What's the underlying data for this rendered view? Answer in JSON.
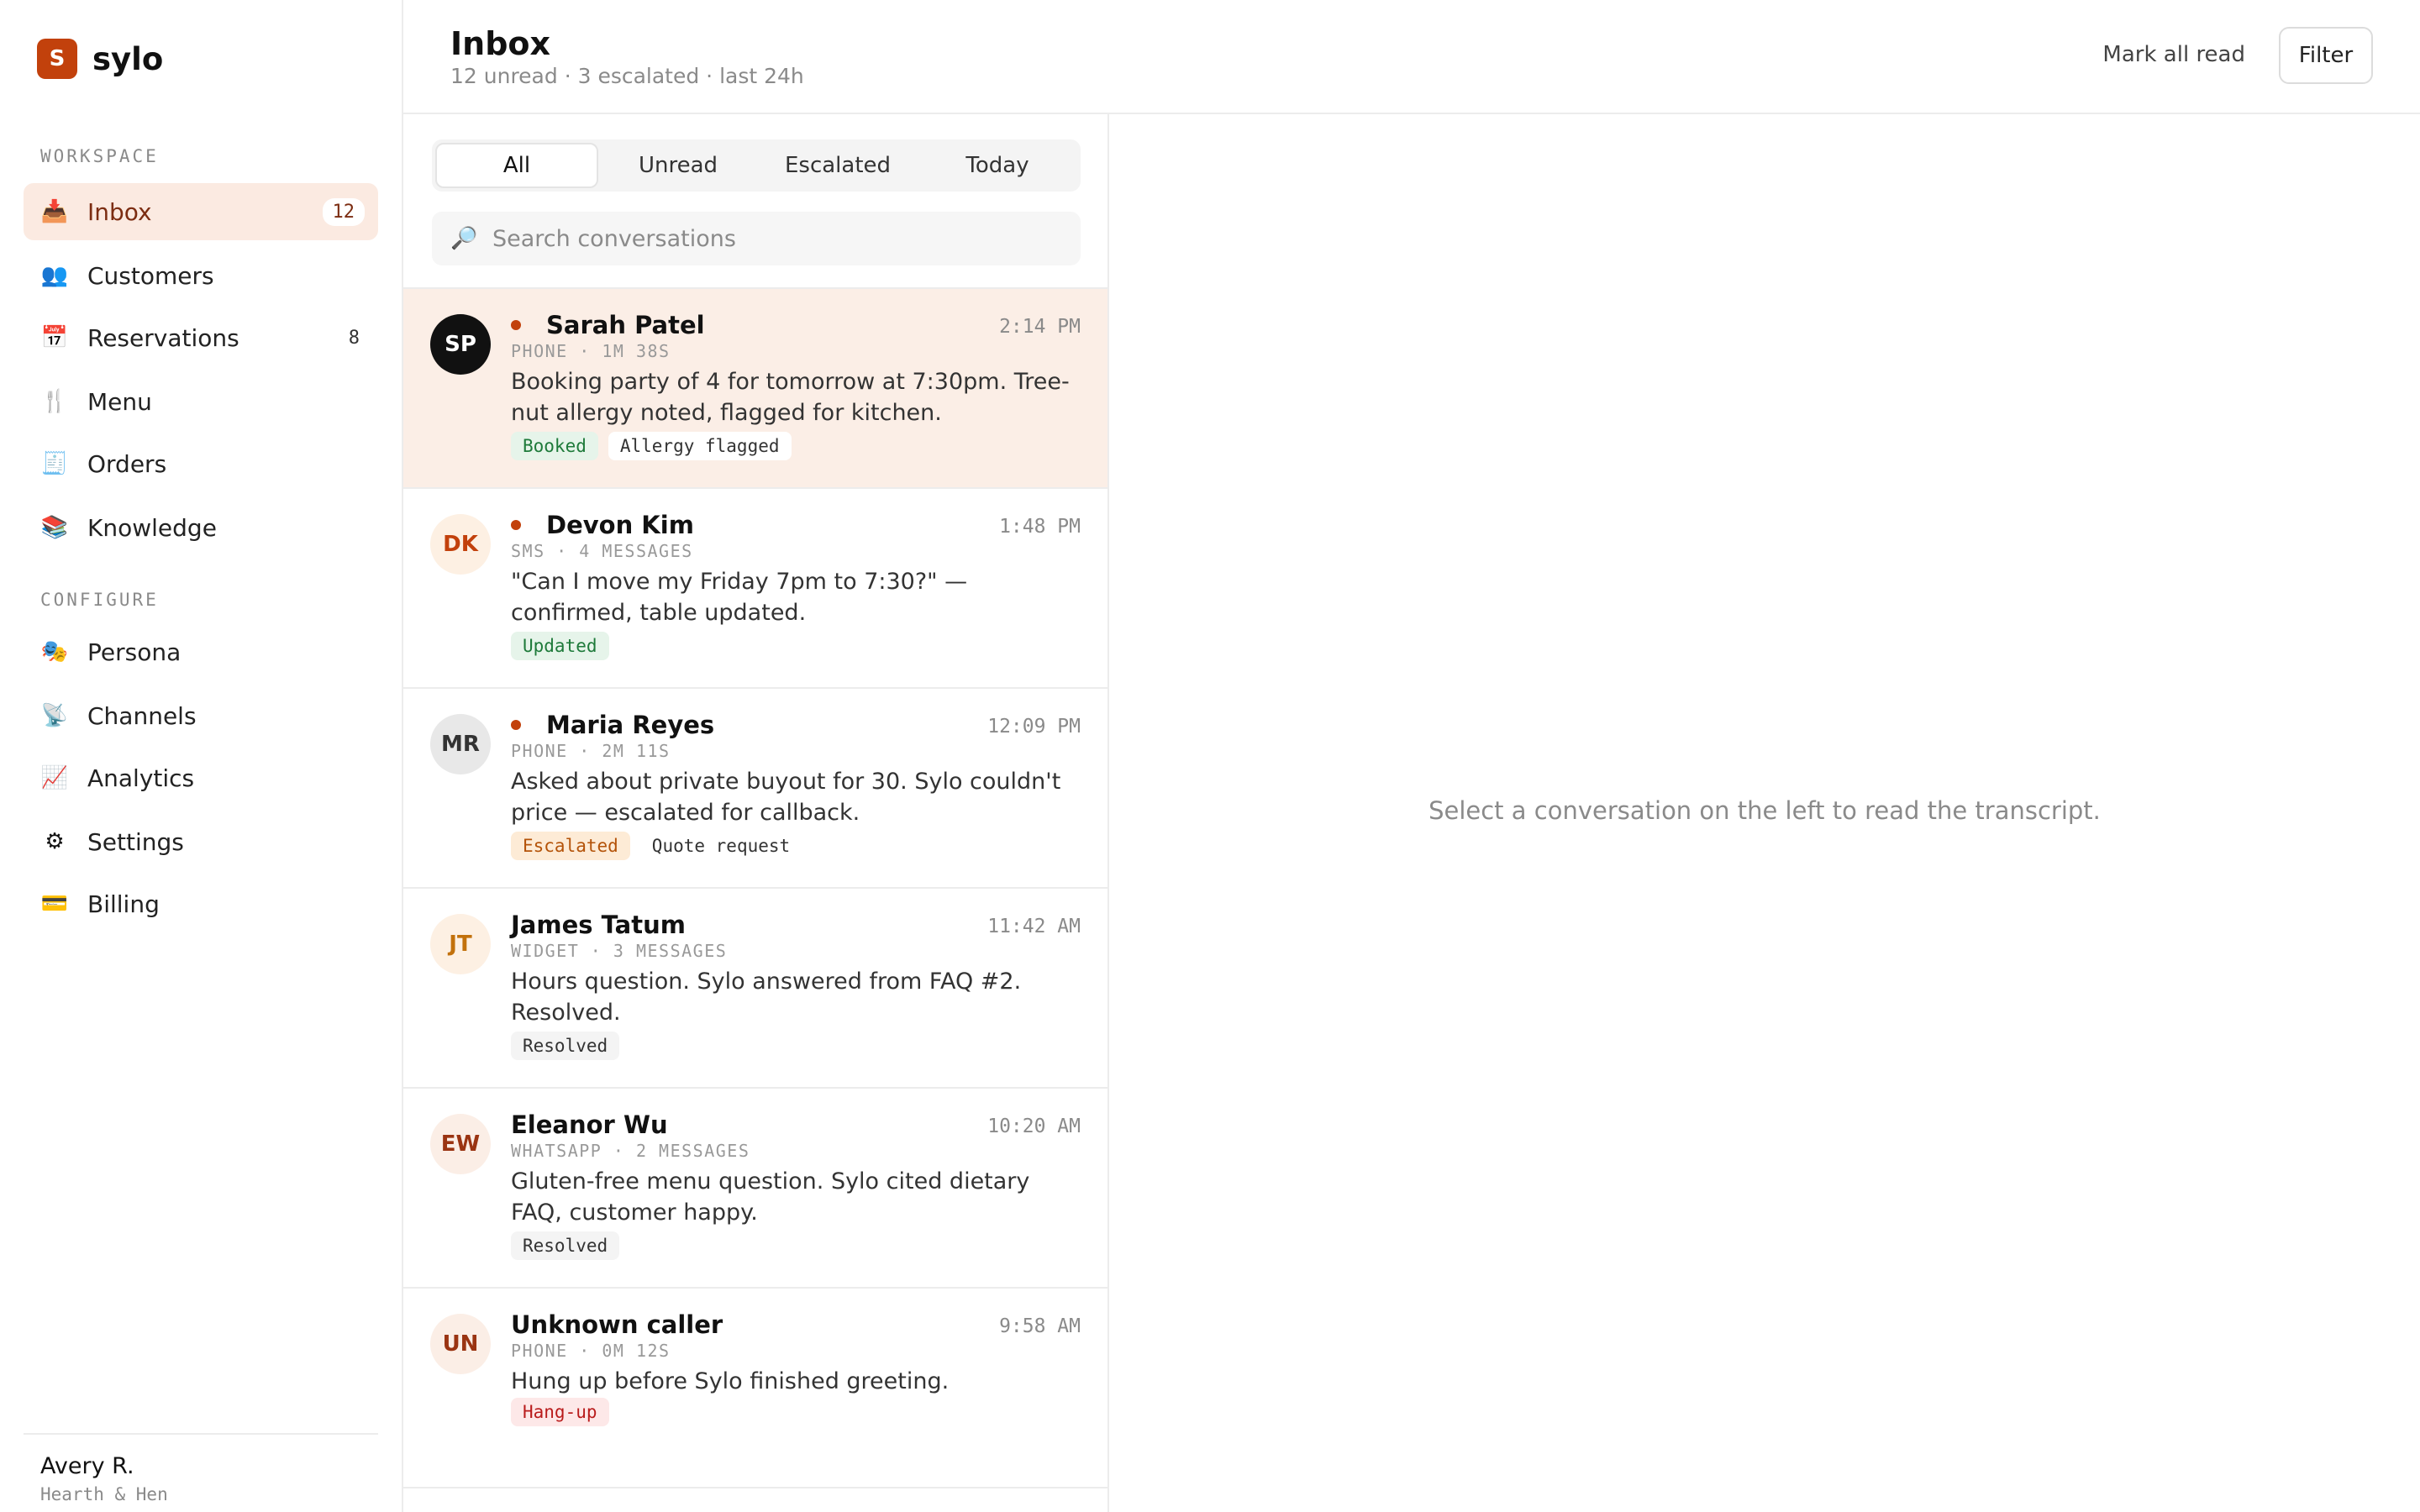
{
  "brand": {
    "mark": "S",
    "name": "sylo"
  },
  "sidebar": {
    "workspace_label": "WORKSPACE",
    "configure_label": "CONFIGURE",
    "workspace_items": [
      {
        "key": "inbox",
        "label": "Inbox",
        "icon": "📥",
        "count": "12",
        "active": true
      },
      {
        "key": "customers",
        "label": "Customers",
        "icon": "👥",
        "count": ""
      },
      {
        "key": "reservations",
        "label": "Reservations",
        "icon": "📅",
        "count": "8"
      },
      {
        "key": "menu",
        "label": "Menu",
        "icon": "🍴",
        "count": ""
      },
      {
        "key": "orders",
        "label": "Orders",
        "icon": "🧾",
        "count": ""
      },
      {
        "key": "knowledge",
        "label": "Knowledge",
        "icon": "📚",
        "count": ""
      }
    ],
    "configure_items": [
      {
        "key": "persona",
        "label": "Persona",
        "icon": "🎭"
      },
      {
        "key": "channels",
        "label": "Channels",
        "icon": "📡"
      },
      {
        "key": "analytics",
        "label": "Analytics",
        "icon": "📈"
      },
      {
        "key": "settings",
        "label": "Settings",
        "icon": "⚙"
      },
      {
        "key": "billing",
        "label": "Billing",
        "icon": "💳"
      }
    ],
    "user": {
      "name": "Avery R.",
      "org": "Hearth & Hen"
    }
  },
  "header": {
    "title": "Inbox",
    "subtitle": "12 unread · 3 escalated · last 24h",
    "mark_all_read": "Mark all read",
    "filter": "Filter"
  },
  "tabs": [
    {
      "label": "All",
      "active": true
    },
    {
      "label": "Unread"
    },
    {
      "label": "Escalated"
    },
    {
      "label": "Today"
    }
  ],
  "search": {
    "placeholder": "Search conversations",
    "value": ""
  },
  "conversations": [
    {
      "initials": "SP",
      "name": "Sarah Patel",
      "unread": true,
      "time": "2:14 PM",
      "meta": "PHONE · 1M 38S",
      "text": "Booking party of 4 for tomorrow at 7:30pm. Tree-nut allergy noted, flagged for kitchen.",
      "avatar_bg": "#111111",
      "avatar_fg": "#ffffff",
      "selected": true,
      "tags": [
        {
          "label": "Booked",
          "bg": "#e6f4ea",
          "fg": "#1e7a3a"
        },
        {
          "label": "Allergy flagged",
          "bg": "#ffffff",
          "fg": "#333333"
        }
      ]
    },
    {
      "initials": "DK",
      "name": "Devon Kim",
      "unread": true,
      "time": "1:48 PM",
      "meta": "SMS · 4 MESSAGES",
      "text": "\"Can I move my Friday 7pm to 7:30?\" — confirmed, table updated.",
      "avatar_bg": "#fdf0e3",
      "avatar_fg": "#c2410c",
      "tags": [
        {
          "label": "Updated",
          "bg": "#e6f4ea",
          "fg": "#1e7a3a"
        }
      ]
    },
    {
      "initials": "MR",
      "name": "Maria Reyes",
      "unread": true,
      "time": "12:09 PM",
      "meta": "PHONE · 2M 11S",
      "text": "Asked about private buyout for 30. Sylo couldn't price — escalated for callback.",
      "avatar_bg": "#e8e8e8",
      "avatar_fg": "#333333",
      "tags": [
        {
          "label": "Escalated",
          "bg": "#fdebd6",
          "fg": "#b45309"
        },
        {
          "label": "Quote request",
          "bg": "#ffffff",
          "fg": "#333333"
        }
      ]
    },
    {
      "initials": "JT",
      "name": "James Tatum",
      "unread": false,
      "time": "11:42 AM",
      "meta": "WIDGET · 3 MESSAGES",
      "text": "Hours question. Sylo answered from FAQ #2. Resolved.",
      "avatar_bg": "#fdf0e3",
      "avatar_fg": "#c2710c",
      "tags": [
        {
          "label": "Resolved",
          "bg": "#f4f4f4",
          "fg": "#333333"
        }
      ]
    },
    {
      "initials": "EW",
      "name": "Eleanor Wu",
      "unread": false,
      "time": "10:20 AM",
      "meta": "WHATSAPP · 2 MESSAGES",
      "text": "Gluten-free menu question. Sylo cited dietary FAQ, customer happy.",
      "avatar_bg": "#fbeee6",
      "avatar_fg": "#9a3412",
      "tags": [
        {
          "label": "Resolved",
          "bg": "#f4f4f4",
          "fg": "#333333"
        }
      ]
    },
    {
      "initials": "UN",
      "name": "Unknown caller",
      "unread": false,
      "time": "9:58 AM",
      "meta": "PHONE · 0M 12S",
      "text": "Hung up before Sylo finished greeting.",
      "avatar_bg": "#fbeee6",
      "avatar_fg": "#9a3412",
      "tags": [
        {
          "label": "Hang-up",
          "bg": "#fde8e8",
          "fg": "#b91c1c"
        }
      ]
    }
  ],
  "detail": {
    "empty_message": "Select a conversation on the left to read the transcript."
  },
  "colors": {
    "accent": "#c2410c",
    "active_bg": "#fbeae1"
  }
}
